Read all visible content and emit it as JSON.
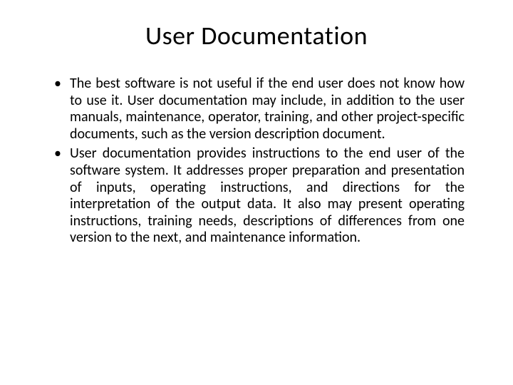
{
  "slide": {
    "title": "User Documentation",
    "bullets": [
      "The best software is not useful if the end user does not know how to use it. User documentation may include, in addition to the user manuals, maintenance, operator, training, and other project-specific documents, such as the version description document.",
      "User documentation provides instructions to the end user of the software system. It addresses proper preparation and presentation of inputs, operating instructions, and directions for the interpretation of the output data. It also may present operating instructions, training needs, descriptions of differences from one version to the next, and maintenance information."
    ]
  }
}
